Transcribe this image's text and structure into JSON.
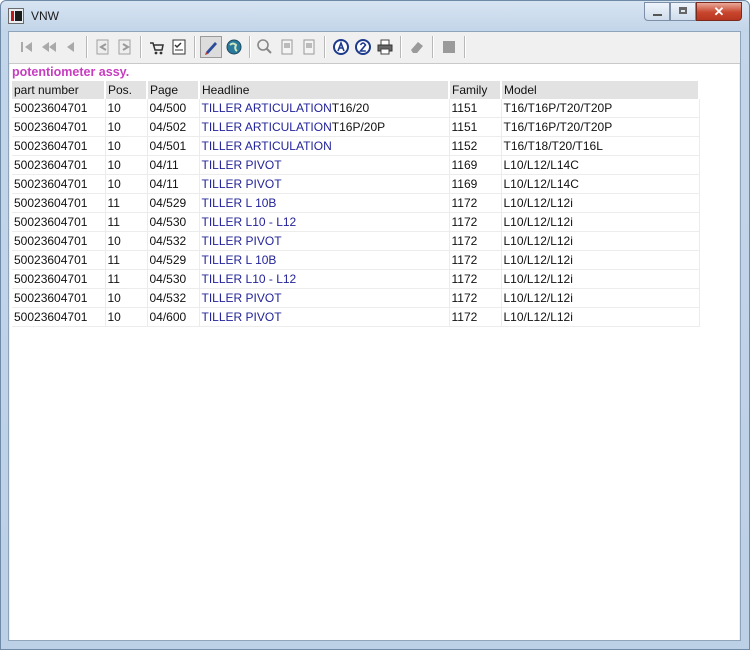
{
  "window": {
    "title": "VNW",
    "close_glyph": "✕"
  },
  "toolbar": {
    "buttons": [
      {
        "name": "first-record",
        "icon": "first-icon"
      },
      {
        "name": "prev-page",
        "icon": "double-left-icon"
      },
      {
        "name": "prev-record",
        "icon": "left-icon"
      },
      {
        "name": "back-doc",
        "icon": "doc-back-icon"
      },
      {
        "name": "forward-doc",
        "icon": "doc-forward-icon"
      },
      {
        "name": "cart",
        "icon": "cart-icon"
      },
      {
        "name": "checklist",
        "icon": "checklist-icon"
      },
      {
        "name": "pencil-tool",
        "icon": "pencil-icon",
        "pressed": true
      },
      {
        "name": "globe",
        "icon": "globe-icon"
      },
      {
        "name": "zoom",
        "icon": "magnifier-icon"
      },
      {
        "name": "page-a",
        "icon": "page-icon"
      },
      {
        "name": "page-b",
        "icon": "page-icon"
      },
      {
        "name": "info-a",
        "icon": "circle-a-icon"
      },
      {
        "name": "info-2",
        "icon": "circle-2-icon"
      },
      {
        "name": "print",
        "icon": "printer-icon"
      },
      {
        "name": "eraser",
        "icon": "eraser-icon"
      },
      {
        "name": "stop",
        "icon": "stop-icon"
      }
    ]
  },
  "result": {
    "caption": "potentiometer assy.",
    "columns": [
      "part number",
      "Pos.",
      "Page",
      "Headline",
      "Family",
      "Model"
    ],
    "rows": [
      {
        "part": "50023604701",
        "pos": "10",
        "page": "04/500",
        "headline_blue": "TILLER ARTICULATION",
        "headline_rest": "T16/20",
        "family": "1151",
        "model": "T16/T16P/T20/T20P"
      },
      {
        "part": "50023604701",
        "pos": "10",
        "page": "04/502",
        "headline_blue": "TILLER ARTICULATION",
        "headline_rest": "T16P/20P",
        "family": "1151",
        "model": "T16/T16P/T20/T20P"
      },
      {
        "part": "50023604701",
        "pos": "10",
        "page": "04/501",
        "headline_blue": "TILLER ARTICULATION",
        "headline_rest": "",
        "family": "1152",
        "model": "T16/T18/T20/T16L"
      },
      {
        "part": "50023604701",
        "pos": "10",
        "page": "04/11",
        "headline_blue": "TILLER PIVOT",
        "headline_rest": "",
        "family": "1169",
        "model": "L10/L12/L14C"
      },
      {
        "part": "50023604701",
        "pos": "10",
        "page": "04/11",
        "headline_blue": "TILLER PIVOT",
        "headline_rest": "",
        "family": "1169",
        "model": "L10/L12/L14C"
      },
      {
        "part": "50023604701",
        "pos": "11",
        "page": "04/529",
        "headline_blue": "TILLER L 10B",
        "headline_rest": "",
        "family": "1172",
        "model": "L10/L12/L12i"
      },
      {
        "part": "50023604701",
        "pos": "11",
        "page": "04/530",
        "headline_blue": "TILLER L10 - L12",
        "headline_rest": "",
        "family": "1172",
        "model": "L10/L12/L12i"
      },
      {
        "part": "50023604701",
        "pos": "10",
        "page": "04/532",
        "headline_blue": "TILLER PIVOT",
        "headline_rest": "",
        "family": "1172",
        "model": "L10/L12/L12i"
      },
      {
        "part": "50023604701",
        "pos": "11",
        "page": "04/529",
        "headline_blue": "TILLER L 10B",
        "headline_rest": "",
        "family": "1172",
        "model": "L10/L12/L12i"
      },
      {
        "part": "50023604701",
        "pos": "11",
        "page": "04/530",
        "headline_blue": "TILLER L10 - L12",
        "headline_rest": "",
        "family": "1172",
        "model": "L10/L12/L12i"
      },
      {
        "part": "50023604701",
        "pos": "10",
        "page": "04/532",
        "headline_blue": "TILLER PIVOT",
        "headline_rest": "",
        "family": "1172",
        "model": "L10/L12/L12i"
      },
      {
        "part": "50023604701",
        "pos": "10",
        "page": "04/600",
        "headline_blue": "TILLER PIVOT",
        "headline_rest": "",
        "family": "1172",
        "model": "L10/L12/L12i"
      }
    ]
  },
  "colors": {
    "caption": "#c83cc0",
    "headline": "#23239a",
    "header_bg": "#e2e2e2"
  }
}
